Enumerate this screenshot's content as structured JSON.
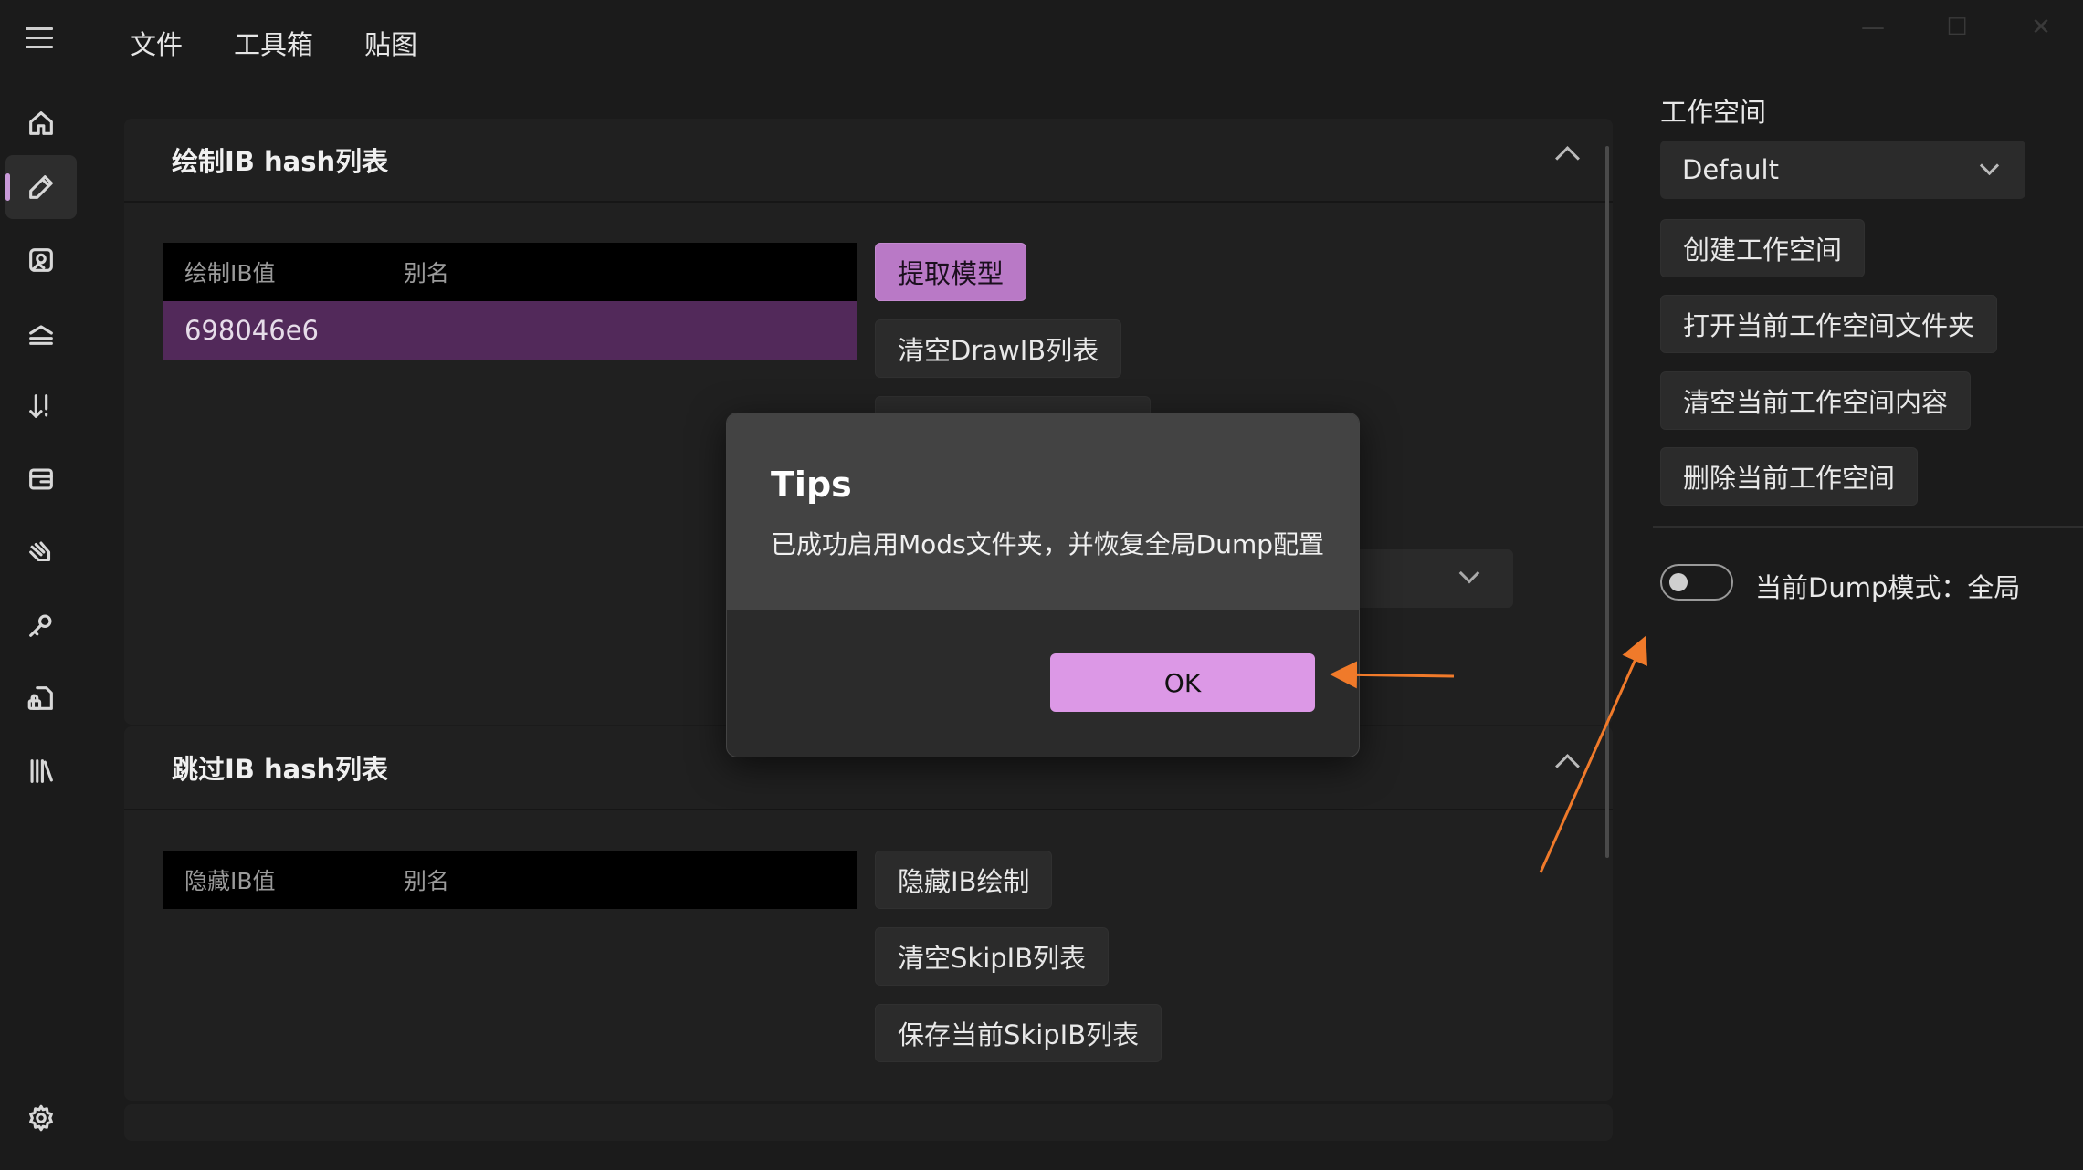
{
  "menu": {
    "file": "文件",
    "toolbox": "工具箱",
    "textures": "贴图"
  },
  "caption": {
    "minimize": "—",
    "maximize": "☐",
    "close": "✕"
  },
  "panel_draw": {
    "title": "绘制IB hash列表",
    "col_value": "绘制IB值",
    "col_alias": "别名",
    "row_value": "698046e6",
    "btn_extract": "提取模型",
    "btn_clear": "清空DrawIB列表"
  },
  "panel_skip": {
    "title": "跳过IB hash列表",
    "col_value": "隐藏IB值",
    "col_alias": "别名",
    "btn_hide": "隐藏IB绘制",
    "btn_clear": "清空SkipIB列表",
    "btn_save": "保存当前SkipIB列表"
  },
  "workspace": {
    "title": "工作空间",
    "selected": "Default",
    "btn_create": "创建工作空间",
    "btn_open_folder": "打开当前工作空间文件夹",
    "btn_clear": "清空当前工作空间内容",
    "btn_delete": "删除当前工作空间",
    "dump_mode_label": "当前Dump模式：全局",
    "dump_toggle_on": false
  },
  "dialog": {
    "title": "Tips",
    "message": "已成功启用Mods文件夹，并恢复全局Dump配置",
    "ok": "OK"
  },
  "colors": {
    "accent": "#b979c6",
    "annotation_arrow": "#f07a2a"
  }
}
